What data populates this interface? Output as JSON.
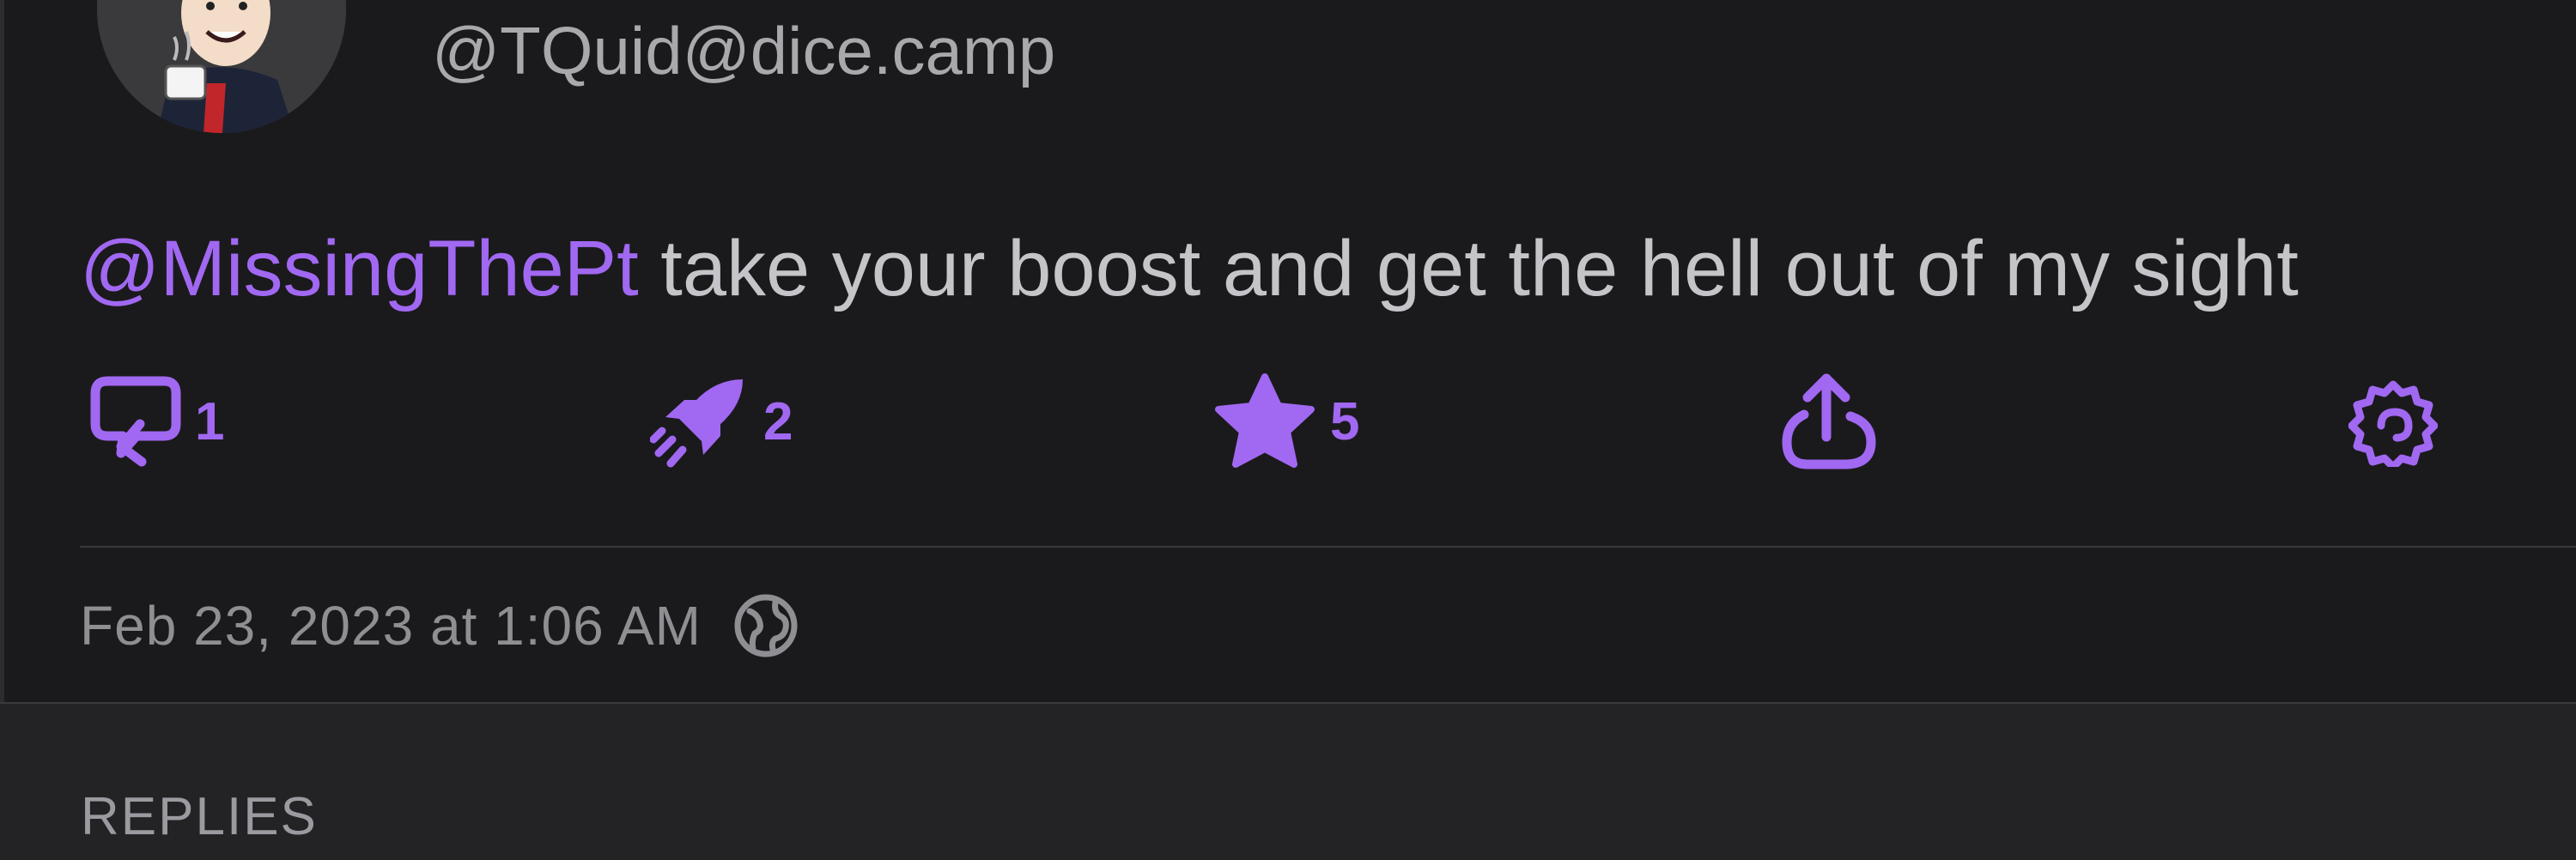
{
  "author": {
    "handle": "@TQuid@dice.camp"
  },
  "post": {
    "mention": "@MissingThePt",
    "text": " take your boost and get the hell out of my sight"
  },
  "actions": {
    "reply_count": "1",
    "boost_count": "2",
    "favorite_count": "5"
  },
  "meta": {
    "timestamp": "Feb 23, 2023 at 1:06 AM"
  },
  "replies": {
    "heading": "REPLIES"
  },
  "icons": {
    "reply": "reply-bubble-icon",
    "boost": "rocket-icon",
    "favorite": "star-icon",
    "share": "share-icon",
    "more": "more-actions-icon",
    "visibility": "globe-icon"
  },
  "colors": {
    "accent": "#a168f2",
    "background": "#1a1a1c",
    "body_text": "#c4c4c9",
    "secondary_text": "#8e8e93"
  }
}
